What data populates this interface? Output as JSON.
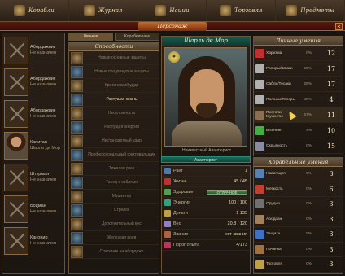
{
  "topnav": [
    {
      "label": "Корабли",
      "icon": "ships-icon"
    },
    {
      "label": "Журнал",
      "icon": "journal-icon"
    },
    {
      "label": "Нации",
      "icon": "nations-icon"
    },
    {
      "label": "Торговля",
      "icon": "trade-icon"
    },
    {
      "label": "Предметы",
      "icon": "items-icon"
    }
  ],
  "title": "Персонаж",
  "close": "×",
  "officers": [
    {
      "name": "Абордажник",
      "status": "Не назначен",
      "kind": "empty"
    },
    {
      "name": "Абордажник",
      "status": "Не назначен",
      "kind": "empty"
    },
    {
      "name": "Абордажник",
      "status": "Не назначен",
      "kind": "empty"
    },
    {
      "name": "Капитан",
      "status": "Шарль де Мор",
      "kind": "portrait"
    },
    {
      "name": "Штурман",
      "status": "Не назначен",
      "kind": "empty"
    },
    {
      "name": "Боцман",
      "status": "Не назначен",
      "kind": "empty"
    },
    {
      "name": "Канонир",
      "status": "Не назначен",
      "kind": "empty"
    }
  ],
  "ability_tabs": [
    "Личные",
    "Корабельные"
  ],
  "abilities_header": "Способности",
  "abilities": [
    {
      "label": "Новые основные защиты",
      "on": false
    },
    {
      "label": "Новые продвинутые защиты",
      "on": false
    },
    {
      "label": "Критический удар",
      "on": false
    },
    {
      "label": "Растущая жизнь",
      "on": true
    },
    {
      "label": "Неотложность",
      "on": false
    },
    {
      "label": "Растущая энергия",
      "on": false
    },
    {
      "label": "Нестандартный удар",
      "on": false
    },
    {
      "label": "Профессиональный фехтовальщик",
      "on": false
    },
    {
      "label": "Тяжелая рука",
      "on": false
    },
    {
      "label": "Танец с саблями",
      "on": false
    },
    {
      "label": "Мушкетер",
      "on": false
    },
    {
      "label": "Стрелок",
      "on": false
    },
    {
      "label": "Дополнительный вес",
      "on": false
    },
    {
      "label": "Железная воля",
      "on": false
    },
    {
      "label": "Спасение на абордаже",
      "on": false
    }
  ],
  "hero": {
    "name": "Шарль де Мор",
    "caption": "Неизвестный Авантюрист",
    "type": "Авантюрист",
    "medal": "✦"
  },
  "stats": [
    {
      "label": "Ранг",
      "value": "1",
      "color": "#4a7ab0"
    },
    {
      "label": "Жизнь",
      "value": "45 / 45",
      "color": "#c03030"
    },
    {
      "label": "Здоровье",
      "value": "ОТЛИЧНОЕ",
      "color": "#50a050",
      "bar": true
    },
    {
      "label": "Энергия",
      "value": "100 / 100",
      "color": "#30a080"
    },
    {
      "label": "Деньги",
      "value": "1 135",
      "color": "#c0a040"
    },
    {
      "label": "Вес",
      "value": "20.8 / 120",
      "color": "#9080c0"
    },
    {
      "label": "Звание",
      "value": "нет звания",
      "color": "#b06040"
    },
    {
      "label": "Порог опыта",
      "value": "4/173",
      "color": "#c03060"
    }
  ],
  "skills_header": "Личные умения",
  "skills": [
    {
      "label": "Харизма",
      "pct": "0%",
      "plus": "",
      "value": "12",
      "color": "#c03030"
    },
    {
      "label": "Рапиры/Шпаги",
      "pct": "59%",
      "plus": "",
      "value": "17",
      "color": "#b0b0b0"
    },
    {
      "label": "Сабли/Тесаки",
      "pct": "28%",
      "plus": "",
      "value": "17",
      "color": "#b0b0b0"
    },
    {
      "label": "Палаши/Топоры",
      "pct": "49%",
      "plus": "",
      "value": "4",
      "color": "#b0b0b0"
    },
    {
      "label": "Пистоли/Мушкеты",
      "pct": "57%",
      "plus": "",
      "value": "11",
      "color": "#8a7050"
    },
    {
      "label": "Везение",
      "pct": "4%",
      "plus": "",
      "value": "10",
      "color": "#40b040"
    },
    {
      "label": "Скрытность",
      "pct": "0%",
      "plus": "",
      "value": "15",
      "color": "#8a8aa0"
    }
  ],
  "ships_header": "Корабельные умения",
  "ship_skills": [
    {
      "label": "Навигация",
      "pct": "0%",
      "value": "3",
      "color": "#5a80b0"
    },
    {
      "label": "Меткость",
      "pct": "0%",
      "value": "6",
      "color": "#c04030"
    },
    {
      "label": "Орудия",
      "pct": "0%",
      "value": "3",
      "color": "#707070"
    },
    {
      "label": "Абордаж",
      "pct": "0%",
      "value": "3",
      "color": "#a08060"
    },
    {
      "label": "Защита",
      "pct": "0%",
      "value": "3",
      "color": "#4070c0"
    },
    {
      "label": "Починка",
      "pct": "0%",
      "value": "3",
      "color": "#a07040"
    },
    {
      "label": "Торговля",
      "pct": "0%",
      "value": "3",
      "color": "#c0a040"
    }
  ]
}
